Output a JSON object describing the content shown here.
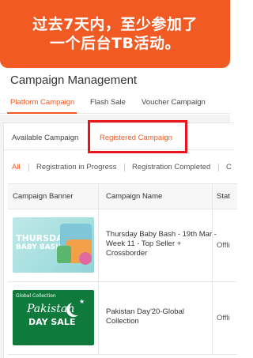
{
  "banner": {
    "line1": "过去7天内，至少参加了",
    "line2": "一个后台TB活动。"
  },
  "page_title": "Campaign Management",
  "main_tabs": [
    "Platform Campaign",
    "Flash Sale",
    "Voucher Campaign"
  ],
  "sub_tabs": [
    "Available Campaign",
    "Registered Campaign"
  ],
  "filters": [
    "All",
    "Registration in Progress",
    "Registration Completed",
    "C"
  ],
  "table": {
    "headers": [
      "Campaign Banner",
      "Campaign Name",
      "Stat"
    ],
    "rows": [
      {
        "name": "Thursday Baby Bash - 19th Mar - Week 11 - Top Seller + Crossborder",
        "status": "Offli",
        "banner_text_1": "THURSDAY",
        "banner_text_2": "BABY BASH"
      },
      {
        "name": "Pakistan Day'20-Global Collection",
        "status": "Offli",
        "banner_text_1": "Pakistan",
        "banner_text_2": "DAY SALE",
        "banner_logo": "Global Collection"
      }
    ]
  },
  "colors": {
    "accent": "#f15a22",
    "highlight": "#e8141b"
  }
}
